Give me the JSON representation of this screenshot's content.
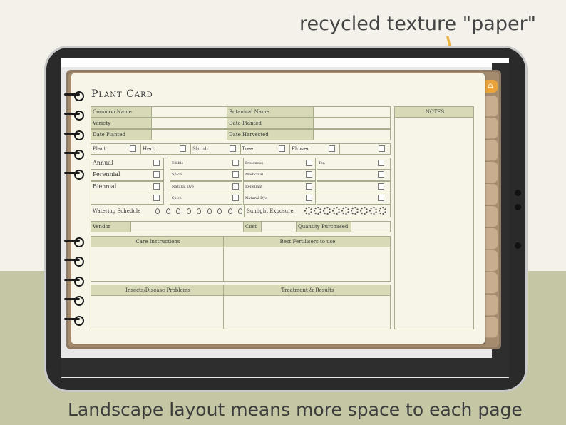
{
  "captions": {
    "top": "recycled texture \"paper\"",
    "bottom": "Landscape layout means more space to each page"
  },
  "colors": {
    "accent_label": "#d7d9b7",
    "home_tab": "#e9a33d",
    "arrow": "#eab448"
  },
  "planner": {
    "title": "Plant Card",
    "notes_header": "NOTES",
    "info_fields": {
      "common_name": "Common Name",
      "botanical_name": "Botanical Name",
      "variety": "Variety",
      "date_planted": "Date Planted",
      "date_planted_2": "Date Planted",
      "date_harvested": "Date Harvested"
    },
    "types": [
      "Plant",
      "Herb",
      "Shrub",
      "Tree",
      "Flower"
    ],
    "lifecycle": [
      "Annual",
      "Perennial",
      "Biennial"
    ],
    "uses_col1": [
      "Edible",
      "Spice",
      "Natural Dye",
      "Spice"
    ],
    "uses_col2": [
      "Posionous",
      "Medicinal",
      "Repellant",
      "Natural Dye"
    ],
    "uses_col3": [
      "Tea"
    ],
    "watering_label": "Watering Schedule",
    "sunlight_label": "Sunlight Exposure",
    "watering_icons": 9,
    "sun_icons": 9,
    "vendor": {
      "vendor": "Vendor",
      "cost": "Cost",
      "quantity": "Quantity Purchased"
    },
    "sections": {
      "care": "Care Instructions",
      "fertilisers": "Best Fertilisers to use",
      "insects": "Insects/Disease Problems",
      "treatment": "Treatment & Results"
    },
    "tab_count": 11
  }
}
